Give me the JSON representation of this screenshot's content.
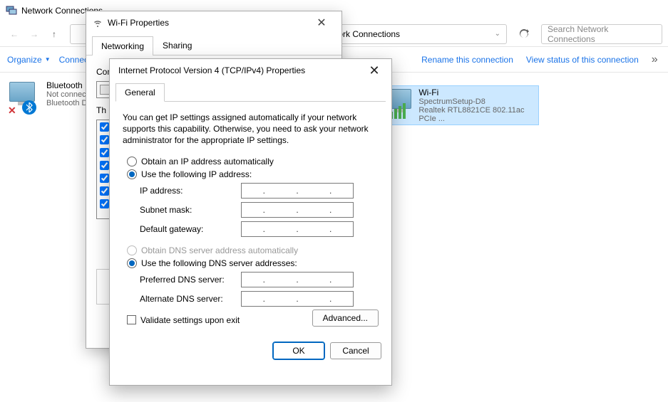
{
  "explorer": {
    "title": "Network Connections",
    "breadcrumb": "Network Connections",
    "search_placeholder": "Search Network Connections",
    "commands": {
      "organize": "Organize",
      "connect": "Connect To",
      "rename": "Rename this connection",
      "status": "View status of this connection"
    },
    "items": [
      {
        "name": "Bluetooth Network Connection",
        "status": "Not connected",
        "device": "Bluetooth Device (Personal Area ...)"
      },
      {
        "name": "Wi-Fi",
        "status": "SpectrumSetup-D8",
        "device": "Realtek RTL8821CE 802.11ac PCIe ..."
      }
    ]
  },
  "wifi_dialog": {
    "title": "Wi-Fi Properties",
    "tabs": [
      "Networking",
      "Sharing"
    ],
    "connect_using_label": "Connect using:",
    "items_label": "This connection uses the following items:"
  },
  "ipv4_dialog": {
    "title": "Internet Protocol Version 4 (TCP/IPv4) Properties",
    "tab": "General",
    "description": "You can get IP settings assigned automatically if your network supports this capability. Otherwise, you need to ask your network administrator for the appropriate IP settings.",
    "radio_ip_auto": "Obtain an IP address automatically",
    "radio_ip_manual": "Use the following IP address:",
    "ip_address_label": "IP address:",
    "subnet_label": "Subnet mask:",
    "gateway_label": "Default gateway:",
    "radio_dns_auto": "Obtain DNS server address automatically",
    "radio_dns_manual": "Use the following DNS server addresses:",
    "pref_dns_label": "Preferred DNS server:",
    "alt_dns_label": "Alternate DNS server:",
    "validate_label": "Validate settings upon exit",
    "advanced_btn": "Advanced...",
    "ok_btn": "OK",
    "cancel_btn": "Cancel",
    "ip_address": "",
    "subnet_mask": "",
    "default_gateway": "",
    "preferred_dns": "",
    "alternate_dns": "",
    "ip_mode": "manual",
    "dns_mode": "manual",
    "validate_on_exit": false
  }
}
